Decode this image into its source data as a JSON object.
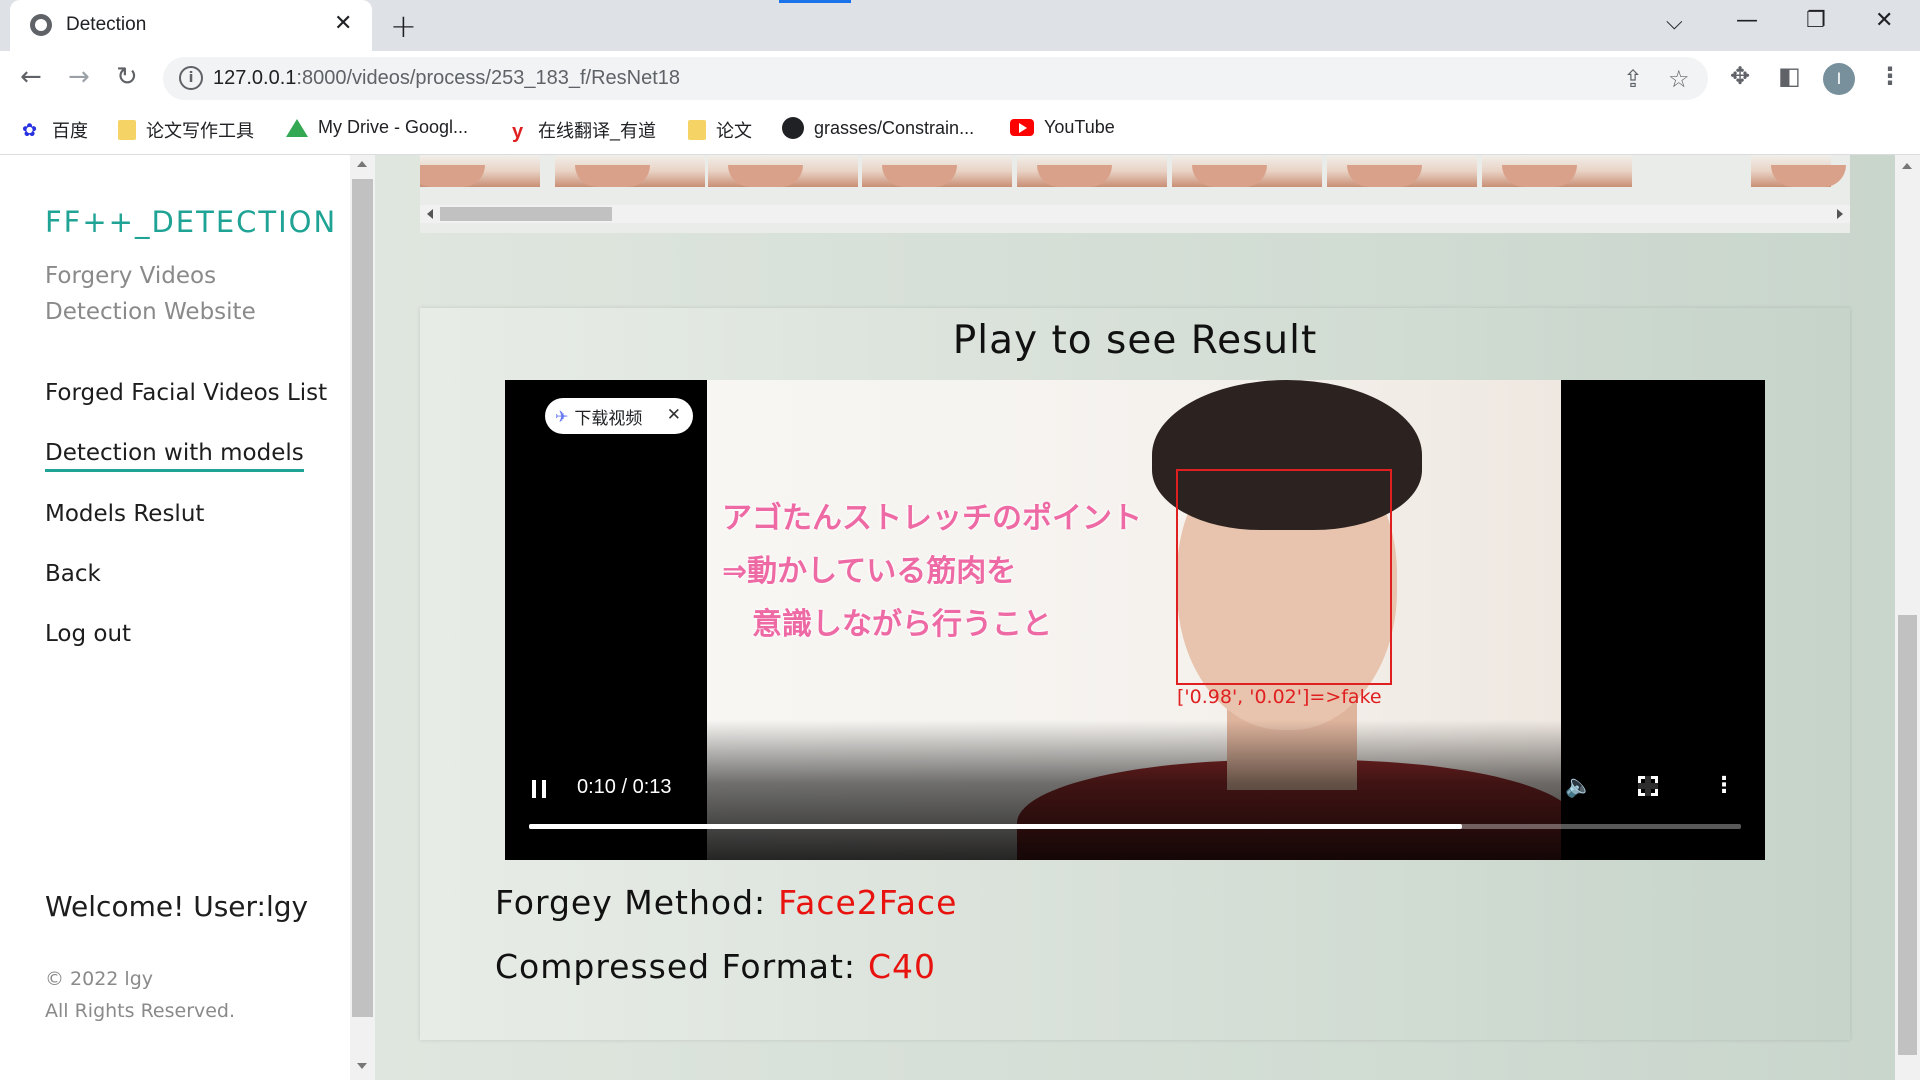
{
  "browser": {
    "tab_title": "Detection",
    "url_host": "127.0.0.1",
    "url_path": ":8000/videos/process/253_183_f/ResNet18",
    "avatar_letter": "I",
    "bookmarks": [
      {
        "label": "百度",
        "icon": "baidu-icon"
      },
      {
        "label": "论文写作工具",
        "icon": "folder-icon"
      },
      {
        "label": "My Drive - Googl...",
        "icon": "google-drive-icon"
      },
      {
        "label": "在线翻译_有道",
        "icon": "youdao-icon"
      },
      {
        "label": "论文",
        "icon": "folder-icon"
      },
      {
        "label": "grasses/Constrain...",
        "icon": "github-icon"
      },
      {
        "label": "YouTube",
        "icon": "youtube-icon"
      }
    ]
  },
  "sidebar": {
    "brand": "FF++_DETECTION",
    "tagline": "Forgery Videos Detection Website",
    "menu": [
      {
        "label": "Forged Facial Videos List",
        "active": false
      },
      {
        "label": "Detection with models",
        "active": true
      },
      {
        "label": "Models Reslut",
        "active": false
      },
      {
        "label": "Back",
        "active": false
      },
      {
        "label": "Log out",
        "active": false
      }
    ],
    "welcome": "Welcome! User:lgy",
    "copyright_line1": "© 2022 lgy",
    "copyright_line2": "All Rights Reserved."
  },
  "result": {
    "title": "Play to see Result",
    "download_pill": "下载视频",
    "video_caption": [
      "アゴたんストレッチのポイント",
      "⇒動かしている筋肉を",
      "　意識しながら行うこと"
    ],
    "detection_label": "['0.98', '0.02']=>fake",
    "time_display": "0:10 / 0:13",
    "progress_fraction": 0.77,
    "method_label": "Forgey Method:",
    "method_value": "Face2Face",
    "format_label": "Compressed Format:",
    "format_value": "C40"
  },
  "colors": {
    "accent": "#1ea394",
    "result_red": "#e8120e",
    "bbox_red": "#e02020"
  }
}
